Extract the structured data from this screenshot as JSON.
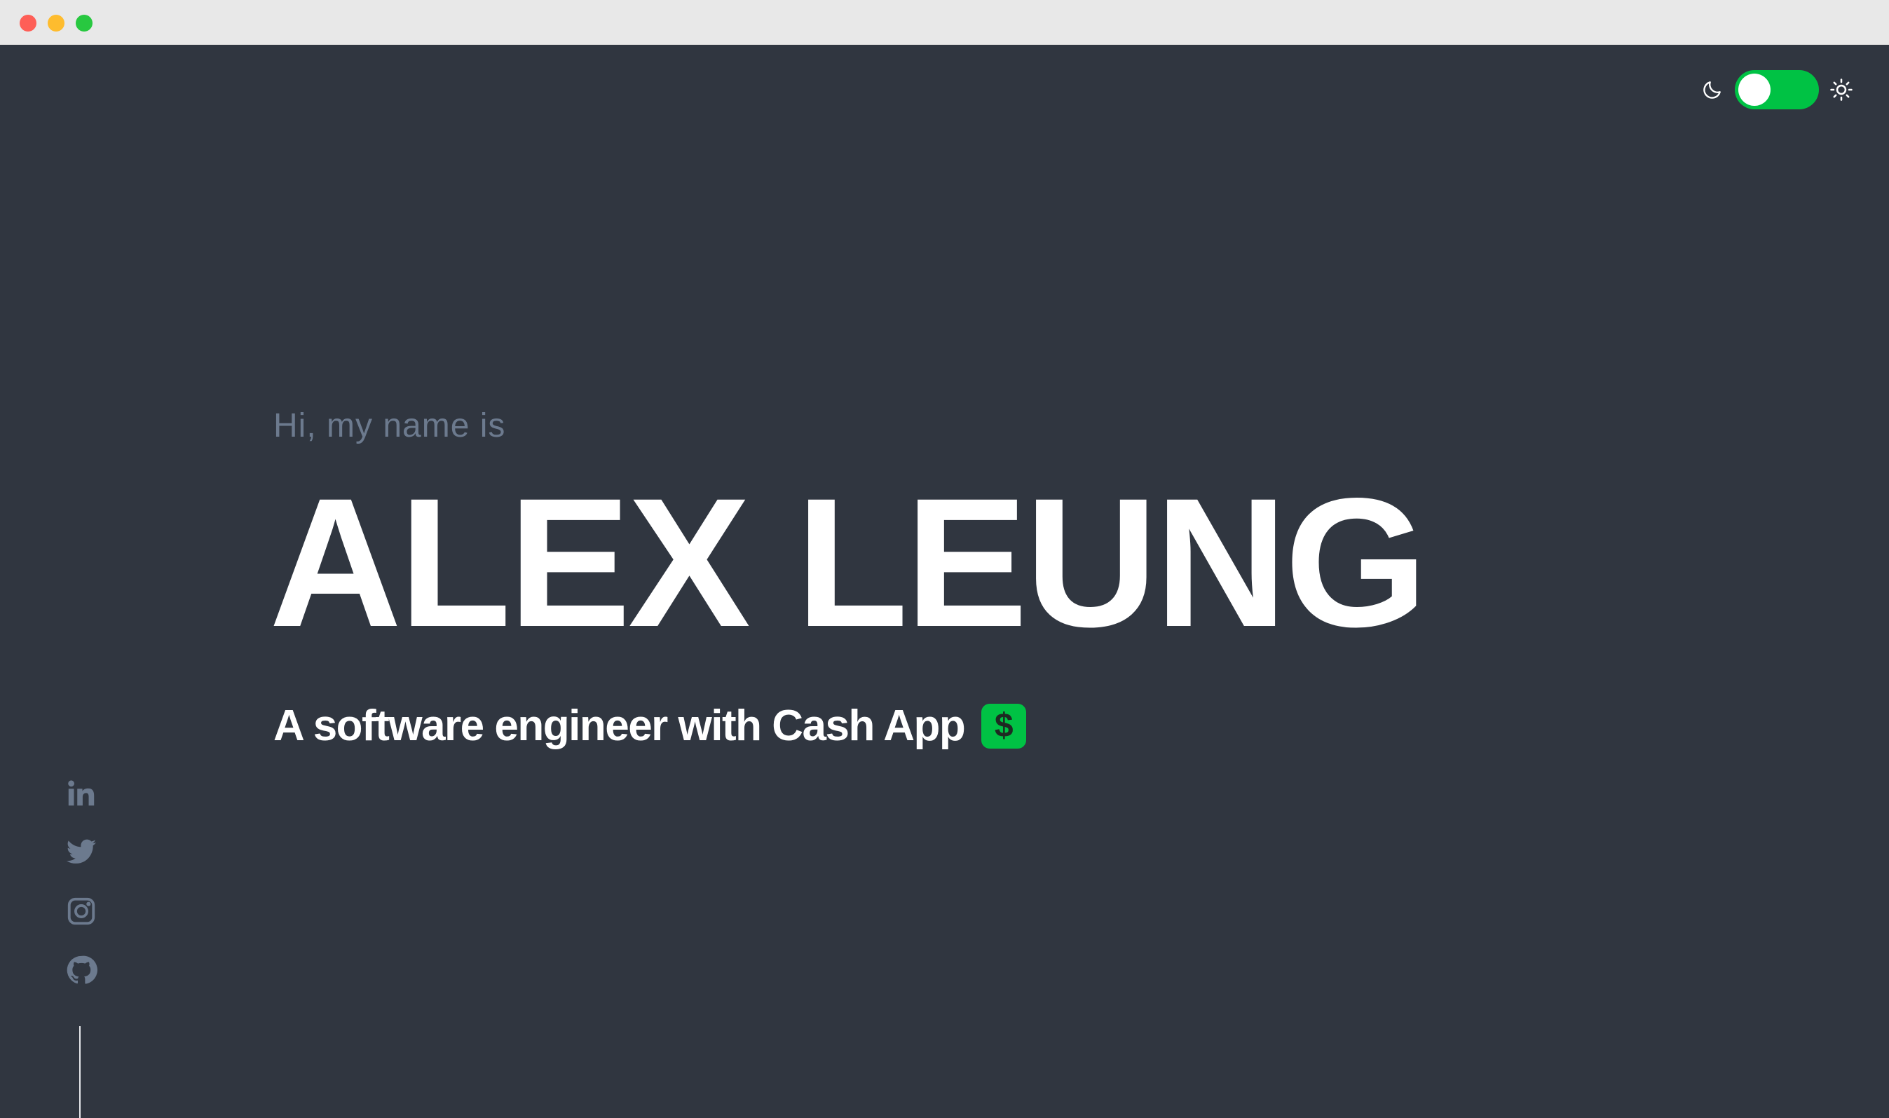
{
  "window": {
    "buttons": [
      "close",
      "minimize",
      "maximize"
    ]
  },
  "theme_toggle": {
    "left_icon": "moon-icon",
    "right_icon": "sun-icon",
    "state": "on",
    "accent_color": "#00c244"
  },
  "hero": {
    "greeting": "Hi, my name is",
    "name": "ALEX LEUNG",
    "tagline": "A software engineer with Cash App",
    "badge_symbol": "$",
    "badge_color": "#00c244"
  },
  "social": {
    "items": [
      {
        "icon": "linkedin-icon"
      },
      {
        "icon": "twitter-icon"
      },
      {
        "icon": "instagram-icon"
      },
      {
        "icon": "github-icon"
      }
    ],
    "icon_color": "#6c7a8e"
  },
  "colors": {
    "background": "#303640",
    "text": "#ffffff",
    "muted": "#6c7a8e"
  }
}
